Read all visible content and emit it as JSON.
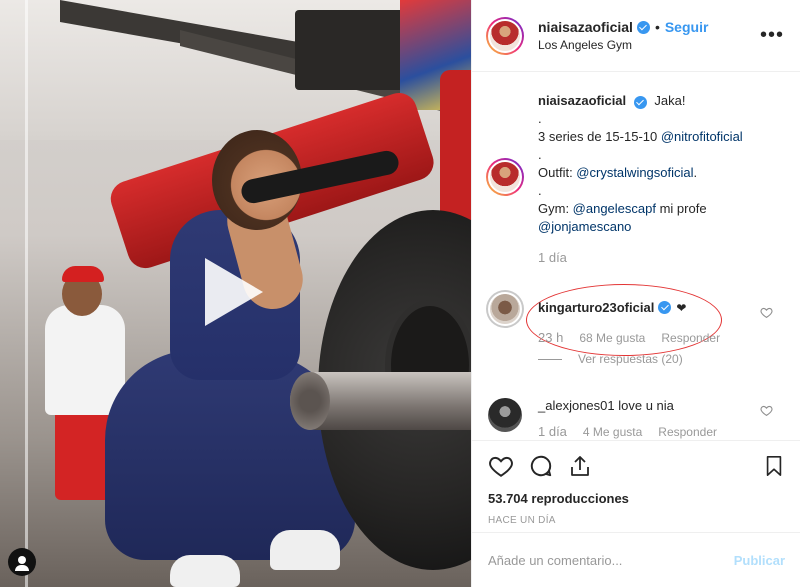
{
  "post": {
    "username": "niaisazaoficial",
    "follow_label": "Seguir",
    "separator": "•",
    "location": "Los Angeles Gym",
    "more_label": "•••"
  },
  "caption": {
    "username": "niaisazaoficial",
    "text": "Jaka!",
    "lines": [
      ".",
      "3 series de 15-15-10 ",
      ".",
      "Outfit: ",
      ".",
      "Gym: "
    ],
    "mention_series": "@nitrofitoficial",
    "mention_outfit": "@crystalwingsoficial",
    "mention_gym": "@angelescapf",
    "gym_suffix": " mi profe",
    "mention_coach": "@jonjamescano",
    "outfit_suffix": ".",
    "time": "1 día"
  },
  "comments": [
    {
      "username": "kingarturo23oficial",
      "text": "❤",
      "time": "23 h",
      "likes": "68 Me gusta",
      "reply_label": "Responder",
      "replies_label": "Ver respuestas (20)"
    },
    {
      "username": "_alexjones01",
      "text": "love u nia",
      "time": "1 día",
      "likes": "4 Me gusta",
      "reply_label": "Responder"
    }
  ],
  "stats": {
    "views_count": "53.704",
    "views_label": "reproducciones",
    "posted_ago": "HACE UN DÍA"
  },
  "add_comment": {
    "placeholder": "Añade un comentario...",
    "publish_label": "Publicar"
  },
  "colors": {
    "accent": "#3897f0",
    "highlight": "#e33535",
    "publish_disabled": "#b2dffc"
  },
  "icons": [
    "play-icon",
    "user-tag-icon",
    "verified-icon",
    "more-icon",
    "heart-icon",
    "comment-icon",
    "share-icon",
    "bookmark-icon"
  ]
}
